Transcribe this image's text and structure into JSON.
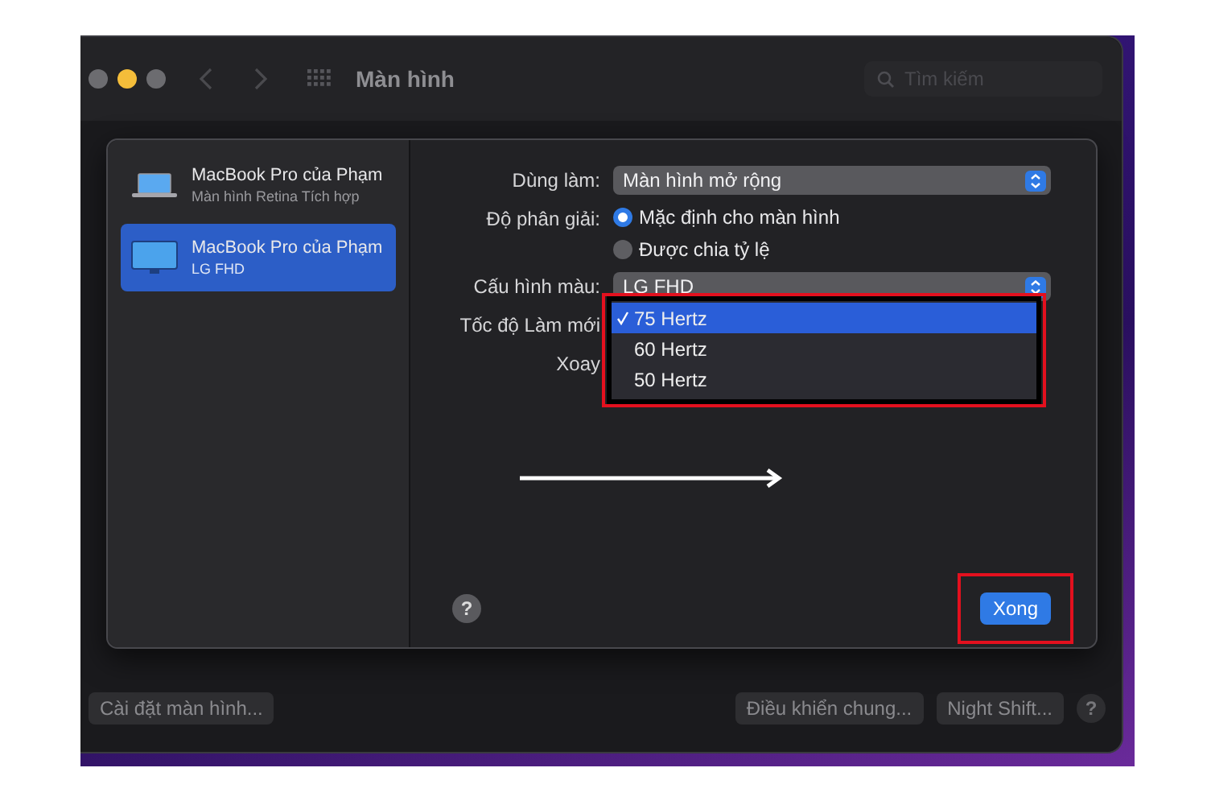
{
  "window": {
    "title": "Màn hình",
    "search": {
      "placeholder": "Tìm kiếm"
    },
    "help": "?"
  },
  "sheet": {
    "displays": [
      {
        "name": "MacBook Pro của Phạm",
        "subtitle": "Màn hình Retina Tích hợp",
        "kind": "laptop",
        "selected": false
      },
      {
        "name": "MacBook Pro của Phạm",
        "subtitle": "LG FHD",
        "kind": "monitor",
        "selected": true
      }
    ],
    "settings": [
      {
        "kind": "popup",
        "label": "Dùng làm:",
        "value": "Màn hình mở rộng"
      },
      {
        "kind": "radio",
        "label": "Độ phân giải:",
        "options": [
          {
            "label": "Mặc định cho màn hình",
            "selected": true
          },
          {
            "label": "Được chia tỷ lệ",
            "selected": false
          }
        ]
      },
      {
        "kind": "popup",
        "label": "Cấu hình màu:",
        "value": "LG FHD"
      },
      {
        "kind": "menu",
        "label": "Tốc độ Làm mới",
        "options": [
          {
            "label": "75 Hertz",
            "selected": true
          },
          {
            "label": "60 Hertz",
            "selected": false
          },
          {
            "label": "50 Hertz",
            "selected": false
          }
        ]
      },
      {
        "kind": "covered",
        "label": "Xoay"
      }
    ],
    "help": "?",
    "done_button": "Xong"
  },
  "bottom_left_buttons": [
    "Cài đặt màn hình..."
  ],
  "bottom_right_buttons": [
    "Điều khiển chung...",
    "Night Shift..."
  ]
}
